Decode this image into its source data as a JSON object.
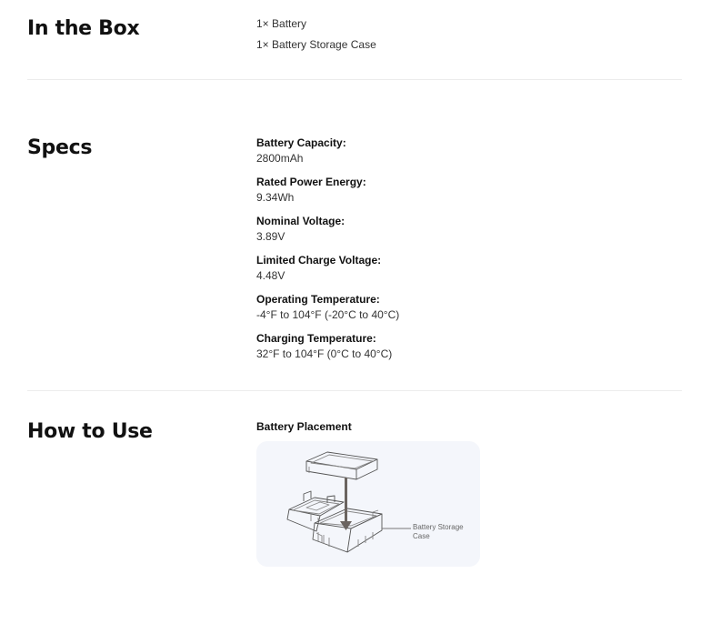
{
  "in_the_box": {
    "title": "In the Box",
    "items": [
      "1× Battery",
      "1× Battery Storage Case"
    ]
  },
  "specs": {
    "title": "Specs",
    "items": [
      {
        "label": "Battery Capacity:",
        "value": "2800mAh"
      },
      {
        "label": "Rated Power Energy:",
        "value": "9.34Wh"
      },
      {
        "label": "Nominal Voltage:",
        "value": "3.89V"
      },
      {
        "label": "Limited Charge Voltage:",
        "value": "4.48V"
      },
      {
        "label": "Operating Temperature:",
        "value": "-4°F to 104°F (-20°C to 40°C)"
      },
      {
        "label": "Charging Temperature:",
        "value": "32°F to 104°F (0°C to 40°C)"
      }
    ]
  },
  "how_to_use": {
    "title": "How to Use",
    "subtitle": "Battery Placement",
    "callout": "Battery Storage Case"
  },
  "colors": {
    "divider": "#ececec",
    "figure_bg": "#f4f6fb",
    "line_art": "#555555",
    "arrow": "#6b6460"
  }
}
